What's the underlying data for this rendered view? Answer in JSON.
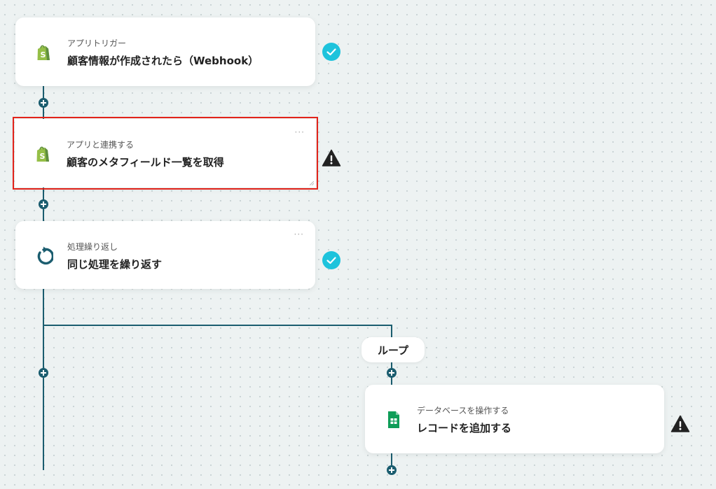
{
  "flow": {
    "steps": [
      {
        "sub": "アプリトリガー",
        "title": "顧客情報が作成されたら（Webhook）",
        "icon": "shopify-icon",
        "status": "check-icon"
      },
      {
        "sub": "アプリと連携する",
        "title": "顧客のメタフィールド一覧を取得",
        "icon": "shopify-icon",
        "status": "warning-icon",
        "menu": "···"
      },
      {
        "sub": "処理繰り返し",
        "title": "同じ処理を繰り返す",
        "icon": "loop-icon",
        "status": "check-icon",
        "menu": "···"
      },
      {
        "sub": "データベースを操作する",
        "title": "レコードを追加する",
        "icon": "google-sheets-icon",
        "status": "warning-icon"
      }
    ],
    "loop_label": "ループ"
  },
  "colors": {
    "connector": "#1b5d6f",
    "check": "#1ec3dc",
    "warning": "#222222",
    "shopify": "#95bf47",
    "sheets": "#0f9d58",
    "selected_border": "#e2231a"
  }
}
